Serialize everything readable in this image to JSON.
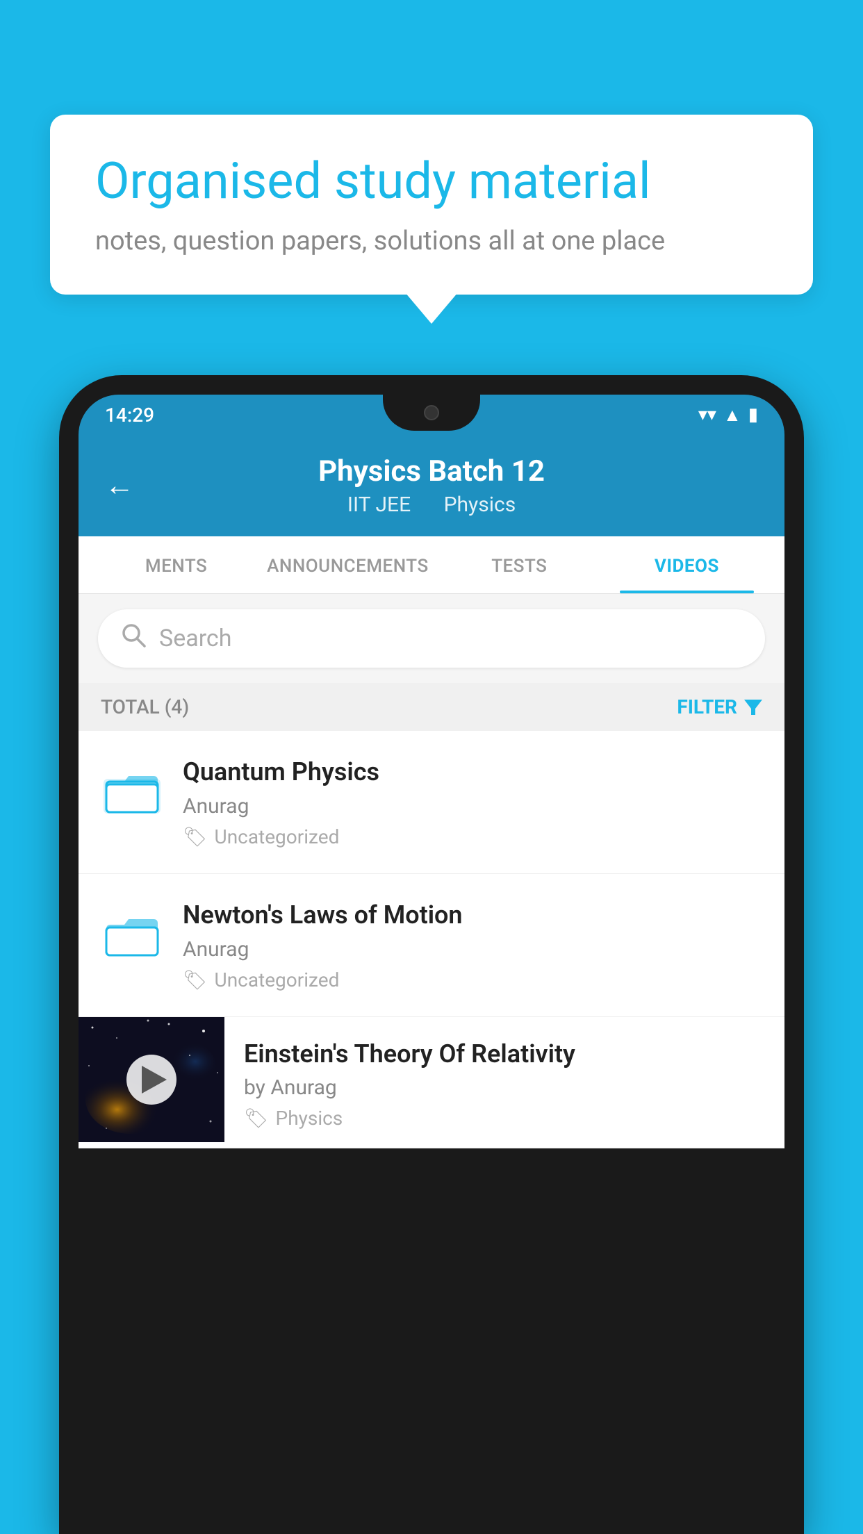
{
  "background_color": "#1BB8E8",
  "bubble": {
    "title": "Organised study material",
    "subtitle": "notes, question papers, solutions all at one place"
  },
  "status_bar": {
    "time": "14:29"
  },
  "header": {
    "title": "Physics Batch 12",
    "subtitle_part1": "IIT JEE",
    "subtitle_part2": "Physics",
    "back_label": "←"
  },
  "tabs": [
    {
      "label": "MENTS",
      "active": false
    },
    {
      "label": "ANNOUNCEMENTS",
      "active": false
    },
    {
      "label": "TESTS",
      "active": false
    },
    {
      "label": "VIDEOS",
      "active": true
    }
  ],
  "search": {
    "placeholder": "Search"
  },
  "filter_bar": {
    "total_label": "TOTAL (4)",
    "filter_label": "FILTER"
  },
  "videos": [
    {
      "title": "Quantum Physics",
      "author": "Anurag",
      "tag": "Uncategorized",
      "has_thumbnail": false
    },
    {
      "title": "Newton's Laws of Motion",
      "author": "Anurag",
      "tag": "Uncategorized",
      "has_thumbnail": false
    },
    {
      "title": "Einstein's Theory Of Relativity",
      "author": "by Anurag",
      "tag": "Physics",
      "has_thumbnail": true
    }
  ]
}
